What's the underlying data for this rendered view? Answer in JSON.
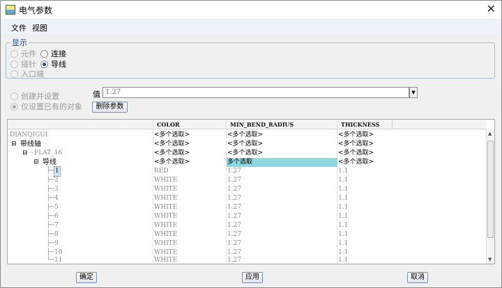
{
  "window": {
    "title": "电气参数",
    "close": "✕"
  },
  "menu": {
    "file": "文件",
    "view": "视图"
  },
  "display": {
    "title": "显示",
    "opt_component": "元件",
    "opt_connection": "连接",
    "opt_pin": "插针",
    "opt_wire": "导线",
    "opt_entry": "入口端",
    "selected": "导线"
  },
  "mode": {
    "create": "创建并设置",
    "only_set": "仅设置已有的对象",
    "selected": "仅设置已有的对象"
  },
  "value": {
    "label": "值",
    "current": "1.27"
  },
  "delete_param_label": "删除参数",
  "table": {
    "headers": [
      "COLOR",
      "MIN_BEND_RADIUS",
      "THICKNESS"
    ],
    "rows": [
      {
        "name": "DIANQIGUI",
        "color": "<多个选取>",
        "radius": "<多个选取>",
        "thickness": "<多个选取>"
      },
      {
        "name": "带线轴",
        "color": "<多个选取>",
        "radius": "<多个选取>",
        "thickness": "<多个选取>"
      },
      {
        "name": "FLAT_16",
        "color": "<多个选取>",
        "radius": "<多个选取>",
        "thickness": "<多个选取>"
      },
      {
        "name": "导线",
        "color": "<多个选取>",
        "radius": "多个选取",
        "thickness": "<多个选取>"
      },
      {
        "name": "1",
        "color": "RED",
        "radius": "1.27",
        "thickness": "1.1"
      },
      {
        "name": "2",
        "color": "WHITE",
        "radius": "1.27",
        "thickness": "1.1"
      },
      {
        "name": "3",
        "color": "WHITE",
        "radius": "1.27",
        "thickness": "1.1"
      },
      {
        "name": "4",
        "color": "WHITE",
        "radius": "1.27",
        "thickness": "1.1"
      },
      {
        "name": "5",
        "color": "WHITE",
        "radius": "1.27",
        "thickness": "1.1"
      },
      {
        "name": "6",
        "color": "WHITE",
        "radius": "1.27",
        "thickness": "1.1"
      },
      {
        "name": "7",
        "color": "WHITE",
        "radius": "1.27",
        "thickness": "1.1"
      },
      {
        "name": "8",
        "color": "WHITE",
        "radius": "1.27",
        "thickness": "1.1"
      },
      {
        "name": "9",
        "color": "WHITE",
        "radius": "1.27",
        "thickness": "1.1"
      },
      {
        "name": "10",
        "color": "WHITE",
        "radius": "1.27",
        "thickness": "1.1"
      },
      {
        "name": "11",
        "color": "WHITE",
        "radius": "1.27",
        "thickness": "1.1"
      }
    ]
  },
  "buttons": {
    "ok": "确定",
    "apply": "应用",
    "cancel": "取消"
  },
  "colors": {
    "highlight": "#8fd8e3",
    "group_border": "#a8bcd3",
    "group_title": "#0b3e9c"
  }
}
